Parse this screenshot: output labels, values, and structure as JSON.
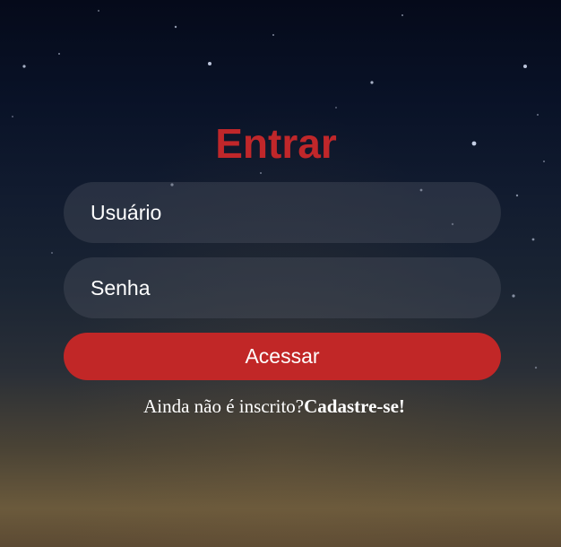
{
  "login": {
    "title": "Entrar",
    "username_placeholder": "Usuário",
    "password_placeholder": "Senha",
    "submit_label": "Acessar",
    "signup_prompt": "Ainda não é inscrito?",
    "signup_link": "Cadastre-se!"
  },
  "colors": {
    "accent": "#c12727",
    "title": "#c0272a",
    "text": "#ffffff"
  }
}
